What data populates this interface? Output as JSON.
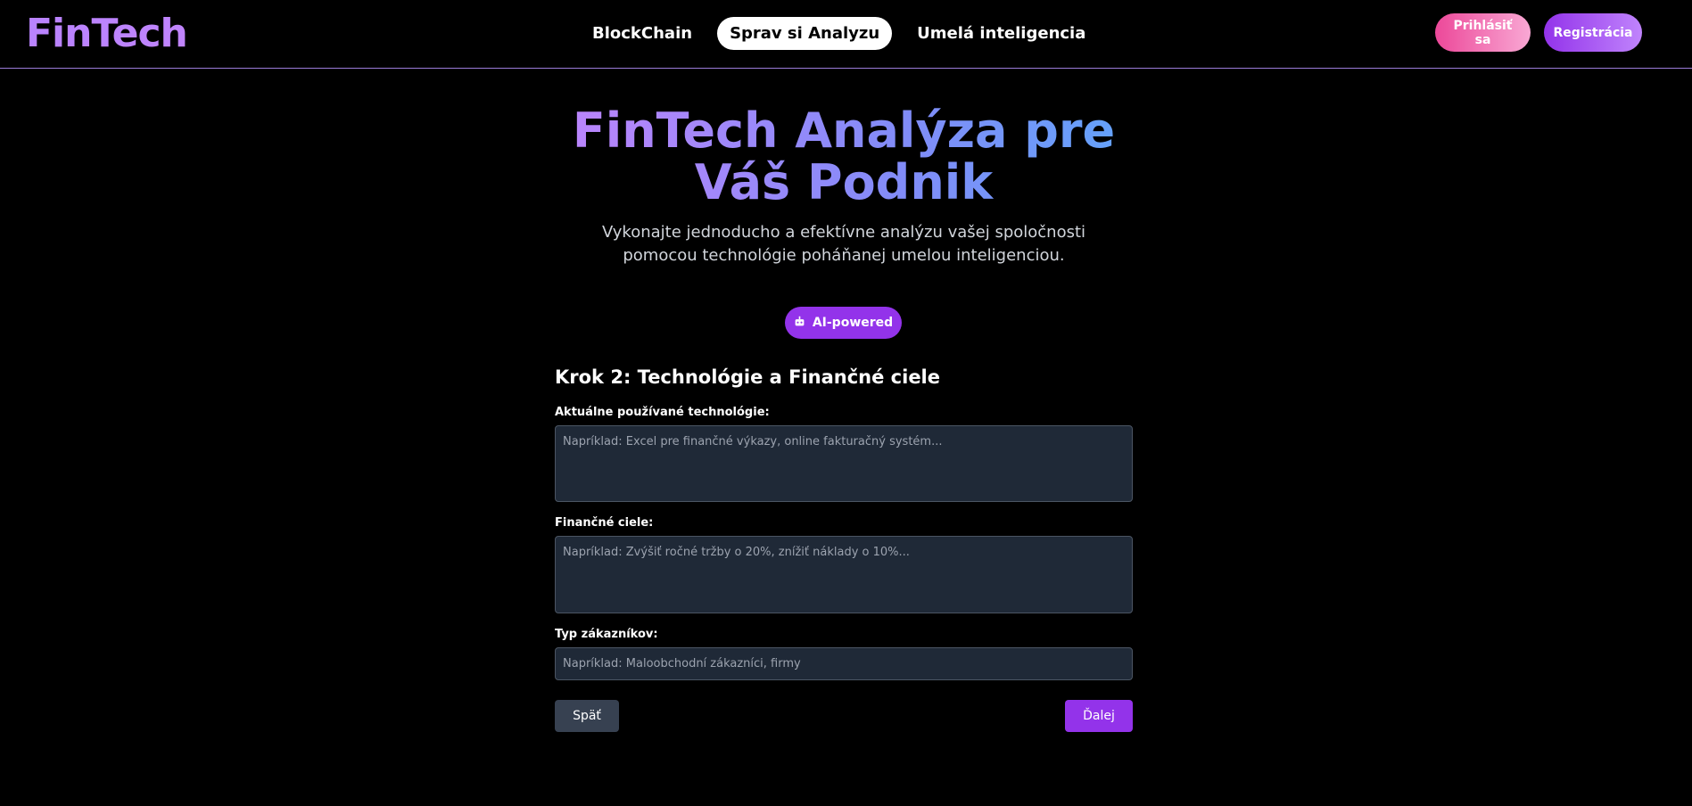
{
  "header": {
    "logo": "FinTech",
    "nav": [
      {
        "label": "BlockChain",
        "active": false
      },
      {
        "label": "Sprav si Analyzu",
        "active": true
      },
      {
        "label": "Umelá inteligencia",
        "active": false
      }
    ],
    "login_label": "Prihlásiť sa",
    "register_label": "Registrácia"
  },
  "hero": {
    "title": "FinTech Analýza pre Váš Podnik",
    "subtitle": "Vykonajte jednoducho a efektívne analýzu vašej spoločnosti pomocou technológie poháňanej umelou inteligenciou.",
    "badge": {
      "icon": "robot-icon",
      "label": "AI-powered"
    }
  },
  "form": {
    "step_title": "Krok 2: Technológie a Finančné ciele",
    "tech_label": "Aktuálne používané technológie:",
    "tech_placeholder": "Napríklad: Excel pre finančné výkazy, online fakturačný systém...",
    "goals_label": "Finančné ciele:",
    "goals_placeholder": "Napríklad: Zvýšiť ročné tržby o 20%, znížiť náklady o 10%...",
    "customers_label": "Typ zákazníkov:",
    "customers_placeholder": "Napríklad: Maloobchodní zákazníci, firmy",
    "back_label": "Späť",
    "next_label": "Ďalej"
  },
  "colors": {
    "accent": "#9333ea",
    "login_gradient": [
      "#ec4899",
      "#f9a8d4"
    ],
    "background": "#000000"
  }
}
